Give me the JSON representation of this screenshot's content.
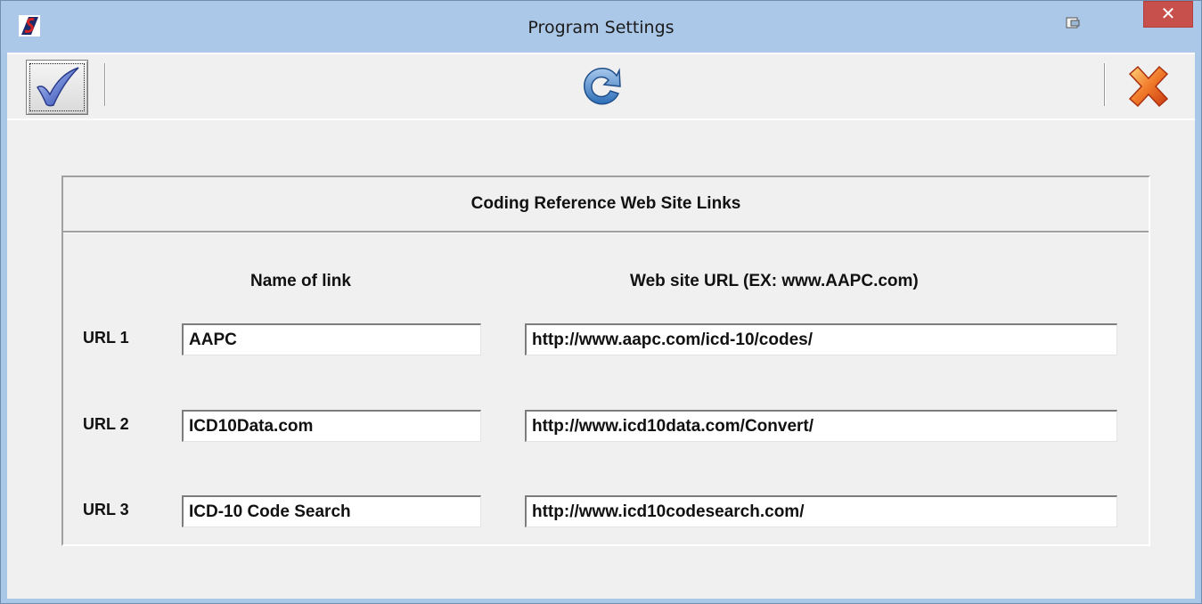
{
  "window": {
    "title": "Program Settings",
    "close_label": "✕"
  },
  "toolbar": {
    "ok_icon": "checkmark-icon",
    "refresh_icon": "refresh-icon",
    "cancel_icon": "red-x-icon"
  },
  "panel": {
    "title": "Coding Reference Web Site Links",
    "col_name": "Name of link",
    "col_url": "Web site URL  (EX:  www.AAPC.com)",
    "rows": [
      {
        "label": "URL 1",
        "name": "AAPC",
        "url": "http://www.aapc.com/icd-10/codes/"
      },
      {
        "label": "URL 2",
        "name": "ICD10Data.com",
        "url": "http://www.icd10data.com/Convert/"
      },
      {
        "label": "URL 3",
        "name": "ICD-10 Code Search",
        "url": "http://www.icd10codesearch.com/"
      }
    ]
  },
  "colors": {
    "titlebar": "#abc8e8",
    "close_button": "#c74f4c",
    "client": "#f0f0f0"
  }
}
